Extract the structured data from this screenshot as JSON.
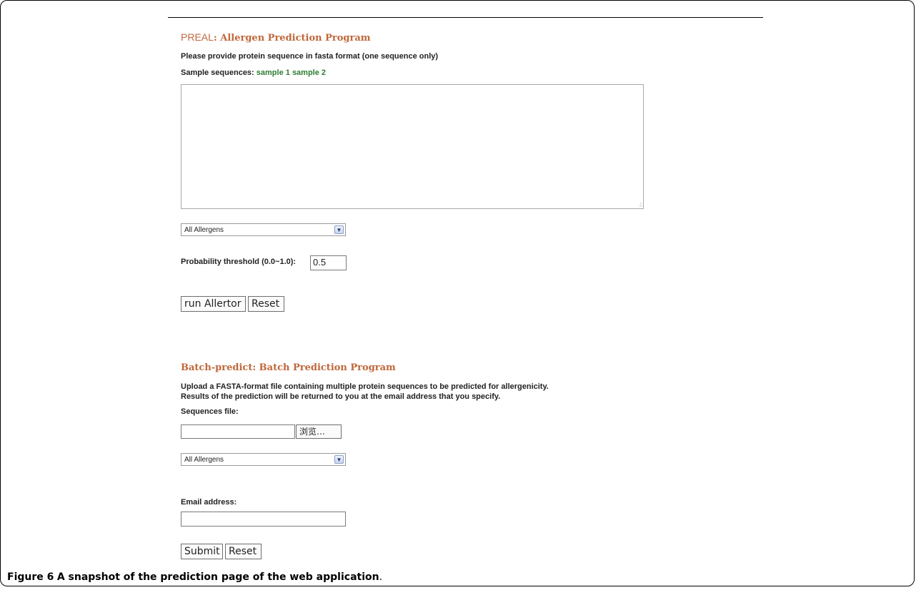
{
  "preal": {
    "title_brand": "PREAL",
    "title_rest": ": Allergen Prediction Program",
    "instruction": "Please provide protein sequence in fasta format (one sequence only)",
    "samples_label": "Sample sequences:",
    "sample_links": [
      "sample 1",
      "sample 2"
    ],
    "sequence_value": "",
    "allergen_select": "All Allergens",
    "threshold_label": "Probability threshold (0.0~1.0):",
    "threshold_value": "0.5",
    "run_button": "run Allertor",
    "reset_button": "Reset"
  },
  "batch": {
    "title": "Batch-predict: Batch Prediction Program",
    "instruction_line1": "Upload a FASTA-format file containing multiple protein sequences to be predicted for allergenicity.",
    "instruction_line2": "Results of the prediction will be returned to you at the email address that you specify.",
    "file_label": "Sequences file:",
    "file_value": "",
    "browse_button": "浏览…",
    "allergen_select": "All Allergens",
    "email_label": "Email address:",
    "email_value": "",
    "submit_button": "Submit",
    "reset_button": "Reset"
  },
  "caption": {
    "label": "Figure 6",
    "text": "A snapshot of the prediction page of the web application",
    "period": "."
  }
}
